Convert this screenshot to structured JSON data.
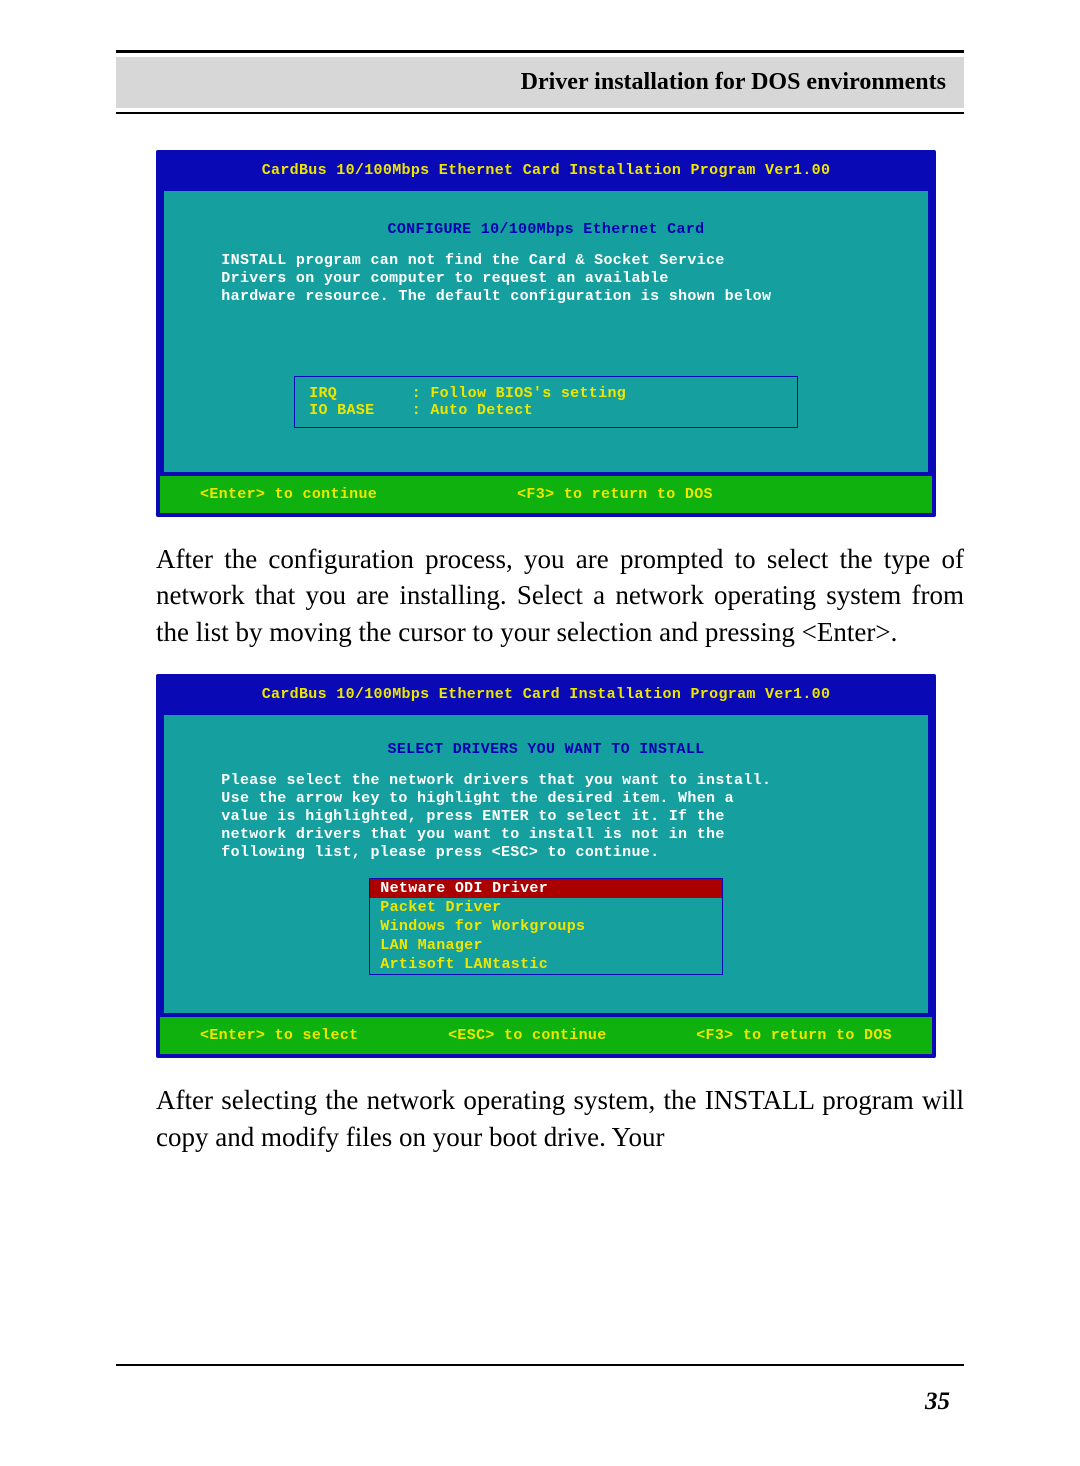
{
  "header": {
    "title": "Driver installation for DOS environments"
  },
  "screenshot1": {
    "program_title": "CardBus 10/100Mbps Ethernet Card Installation Program Ver1.00",
    "section_title": "CONFIGURE 10/100Mbps Ethernet Card",
    "message_lines": [
      "INSTALL program can not find the Card & Socket Service",
      "Drivers on your computer to request an available",
      "hardware resource. The default configuration is shown below"
    ],
    "fields": [
      {
        "label": "IRQ",
        "value": "Follow BIOS's setting"
      },
      {
        "label": "IO BASE",
        "value": "Auto Detect"
      }
    ],
    "footer": [
      "<Enter> to continue",
      "<F3> to return to DOS"
    ]
  },
  "paragraph1": "After the configuration process, you are prompted to select the type of network that you are installing. Select a network operating system from the list by moving the cursor to your selection and pressing <Enter>.",
  "screenshot2": {
    "program_title": "CardBus 10/100Mbps Ethernet Card Installation Program Ver1.00",
    "section_title": "SELECT DRIVERS YOU WANT TO INSTALL",
    "message_lines": [
      "Please select the network drivers that you want to install.",
      "Use the arrow key to highlight the desired item. When a",
      "value is highlighted, press ENTER to select it. If the",
      "network drivers that you want to install is not in the",
      "following list, please press <ESC> to continue."
    ],
    "drivers": [
      {
        "name": "Netware ODI Driver",
        "selected": true
      },
      {
        "name": "Packet Driver",
        "selected": false
      },
      {
        "name": "Windows for Workgroups",
        "selected": false
      },
      {
        "name": "LAN Manager",
        "selected": false
      },
      {
        "name": "Artisoft LANtastic",
        "selected": false
      }
    ],
    "footer": [
      "<Enter> to select",
      "<ESC> to continue",
      "<F3> to return to DOS"
    ]
  },
  "paragraph2": "After selecting the network operating system, the INSTALL program will copy and modify files on your boot drive. Your",
  "page_number": "35"
}
